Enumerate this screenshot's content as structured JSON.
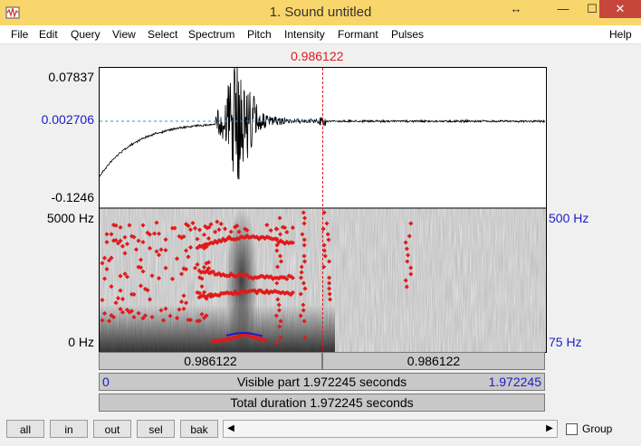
{
  "window": {
    "title": "1. Sound untitled",
    "resize_glyph": "↔",
    "minimize_glyph": "—",
    "maximize_glyph": "☐",
    "close_glyph": "✕",
    "icon": "praat-app-icon"
  },
  "menu": {
    "items": [
      "File",
      "Edit",
      "Query",
      "View",
      "Select",
      "Spectrum",
      "Pitch",
      "Intensity",
      "Formant",
      "Pulses"
    ],
    "help": "Help"
  },
  "cursor": {
    "time_label": "0.986122"
  },
  "waveform": {
    "max_label": "0.07837",
    "cursor_value_label": "0.002706",
    "min_label": "-0.1246"
  },
  "spectrogram": {
    "freq_top_label": "5000 Hz",
    "freq_bottom_label": "0 Hz",
    "pitch_top_label": "500 Hz",
    "pitch_bottom_label": "75 Hz"
  },
  "timebars": {
    "left_segment": "0.986122",
    "right_segment": "0.986122",
    "visible_start": "0",
    "visible_part": "Visible part 1.972245 seconds",
    "visible_end": "1.972245",
    "total_duration": "Total duration 1.972245 seconds"
  },
  "buttons": {
    "all": "all",
    "in": "in",
    "out": "out",
    "sel": "sel",
    "bak": "bak"
  },
  "scroll": {
    "left_arrow": "◀",
    "right_arrow": "▶"
  },
  "group": {
    "label": "Group",
    "checked": false
  },
  "colors": {
    "cursor": "#e01a1a",
    "formant": "#e01a1a",
    "pitch": "#1c1cc8",
    "title_bar": "#f9d66b"
  }
}
